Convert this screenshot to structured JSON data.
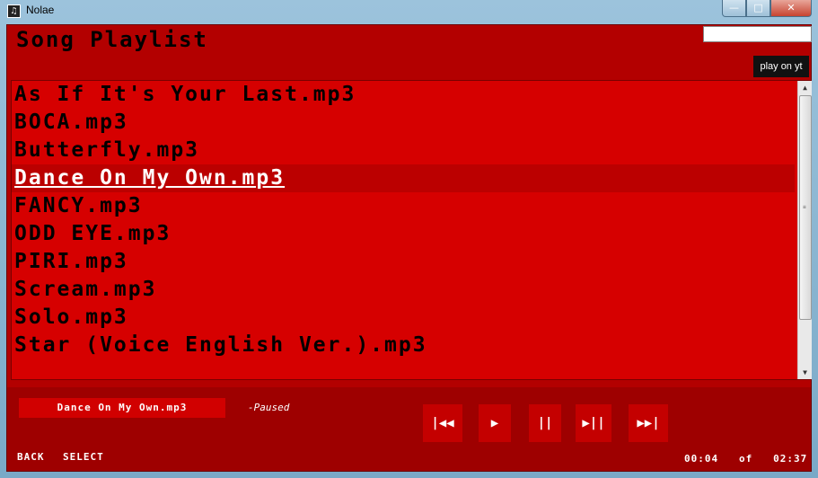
{
  "window": {
    "title": "Nolae"
  },
  "header": {
    "title": "Song Playlist"
  },
  "yt_button": "play on yt",
  "playlist": [
    "As If It's Your Last.mp3",
    "BOCA.mp3",
    "Butterfly.mp3",
    "Dance On My Own.mp3",
    "FANCY.mp3",
    "ODD EYE.mp3",
    "PIRI.mp3",
    "Scream.mp3",
    "Solo.mp3",
    "Star (Voice English Ver.).mp3"
  ],
  "selected_index": 3,
  "now_playing": "Dance On My Own.mp3",
  "status": "-Paused",
  "controls": {
    "prev": "|◀◀",
    "play": "▶",
    "pause": "||",
    "step": "▶||",
    "next": "▶▶|"
  },
  "footer": {
    "back": "BACK",
    "select": "SELECT",
    "elapsed": "00:04",
    "of": "of",
    "total": "02:37"
  },
  "colors": {
    "background": "#b30000",
    "list": "#d60000",
    "selected_row": "#bb0000",
    "footer": "#9e0000"
  }
}
